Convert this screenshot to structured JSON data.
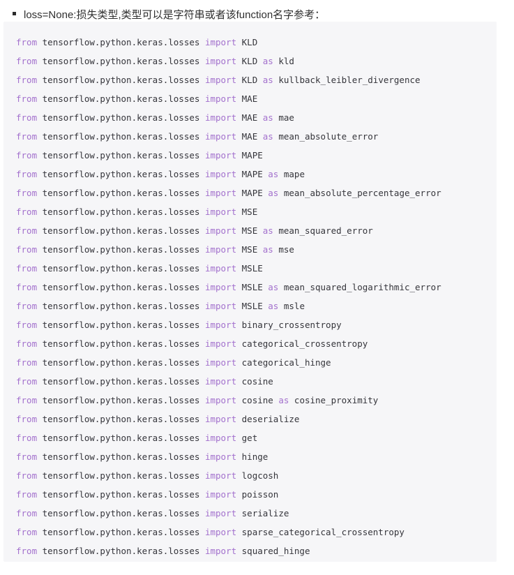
{
  "heading": {
    "bullet_icon": "square-bullet-icon",
    "text": "loss=None:损失类型,类型可以是字符串或者该function名字参考："
  },
  "code_block": {
    "language": "python",
    "background_color": "#f6f6f8",
    "keyword_color": "#a371cd",
    "text_color": "#35353b",
    "module": "tensorflow.python.keras.losses",
    "lines": [
      {
        "from_kw": "from",
        "module": "tensorflow.python.keras.losses",
        "import_kw": "import",
        "name": "KLD",
        "as_kw": "",
        "alias": ""
      },
      {
        "from_kw": "from",
        "module": "tensorflow.python.keras.losses",
        "import_kw": "import",
        "name": "KLD",
        "as_kw": "as",
        "alias": "kld"
      },
      {
        "from_kw": "from",
        "module": "tensorflow.python.keras.losses",
        "import_kw": "import",
        "name": "KLD",
        "as_kw": "as",
        "alias": "kullback_leibler_divergence"
      },
      {
        "from_kw": "from",
        "module": "tensorflow.python.keras.losses",
        "import_kw": "import",
        "name": "MAE",
        "as_kw": "",
        "alias": ""
      },
      {
        "from_kw": "from",
        "module": "tensorflow.python.keras.losses",
        "import_kw": "import",
        "name": "MAE",
        "as_kw": "as",
        "alias": "mae"
      },
      {
        "from_kw": "from",
        "module": "tensorflow.python.keras.losses",
        "import_kw": "import",
        "name": "MAE",
        "as_kw": "as",
        "alias": "mean_absolute_error"
      },
      {
        "from_kw": "from",
        "module": "tensorflow.python.keras.losses",
        "import_kw": "import",
        "name": "MAPE",
        "as_kw": "",
        "alias": ""
      },
      {
        "from_kw": "from",
        "module": "tensorflow.python.keras.losses",
        "import_kw": "import",
        "name": "MAPE",
        "as_kw": "as",
        "alias": "mape"
      },
      {
        "from_kw": "from",
        "module": "tensorflow.python.keras.losses",
        "import_kw": "import",
        "name": "MAPE",
        "as_kw": "as",
        "alias": "mean_absolute_percentage_error"
      },
      {
        "from_kw": "from",
        "module": "tensorflow.python.keras.losses",
        "import_kw": "import",
        "name": "MSE",
        "as_kw": "",
        "alias": ""
      },
      {
        "from_kw": "from",
        "module": "tensorflow.python.keras.losses",
        "import_kw": "import",
        "name": "MSE",
        "as_kw": "as",
        "alias": "mean_squared_error"
      },
      {
        "from_kw": "from",
        "module": "tensorflow.python.keras.losses",
        "import_kw": "import",
        "name": "MSE",
        "as_kw": "as",
        "alias": "mse"
      },
      {
        "from_kw": "from",
        "module": "tensorflow.python.keras.losses",
        "import_kw": "import",
        "name": "MSLE",
        "as_kw": "",
        "alias": ""
      },
      {
        "from_kw": "from",
        "module": "tensorflow.python.keras.losses",
        "import_kw": "import",
        "name": "MSLE",
        "as_kw": "as",
        "alias": "mean_squared_logarithmic_error"
      },
      {
        "from_kw": "from",
        "module": "tensorflow.python.keras.losses",
        "import_kw": "import",
        "name": "MSLE",
        "as_kw": "as",
        "alias": "msle"
      },
      {
        "from_kw": "from",
        "module": "tensorflow.python.keras.losses",
        "import_kw": "import",
        "name": "binary_crossentropy",
        "as_kw": "",
        "alias": ""
      },
      {
        "from_kw": "from",
        "module": "tensorflow.python.keras.losses",
        "import_kw": "import",
        "name": "categorical_crossentropy",
        "as_kw": "",
        "alias": ""
      },
      {
        "from_kw": "from",
        "module": "tensorflow.python.keras.losses",
        "import_kw": "import",
        "name": "categorical_hinge",
        "as_kw": "",
        "alias": ""
      },
      {
        "from_kw": "from",
        "module": "tensorflow.python.keras.losses",
        "import_kw": "import",
        "name": "cosine",
        "as_kw": "",
        "alias": ""
      },
      {
        "from_kw": "from",
        "module": "tensorflow.python.keras.losses",
        "import_kw": "import",
        "name": "cosine",
        "as_kw": "as",
        "alias": "cosine_proximity"
      },
      {
        "from_kw": "from",
        "module": "tensorflow.python.keras.losses",
        "import_kw": "import",
        "name": "deserialize",
        "as_kw": "",
        "alias": ""
      },
      {
        "from_kw": "from",
        "module": "tensorflow.python.keras.losses",
        "import_kw": "import",
        "name": "get",
        "as_kw": "",
        "alias": ""
      },
      {
        "from_kw": "from",
        "module": "tensorflow.python.keras.losses",
        "import_kw": "import",
        "name": "hinge",
        "as_kw": "",
        "alias": ""
      },
      {
        "from_kw": "from",
        "module": "tensorflow.python.keras.losses",
        "import_kw": "import",
        "name": "logcosh",
        "as_kw": "",
        "alias": ""
      },
      {
        "from_kw": "from",
        "module": "tensorflow.python.keras.losses",
        "import_kw": "import",
        "name": "poisson",
        "as_kw": "",
        "alias": ""
      },
      {
        "from_kw": "from",
        "module": "tensorflow.python.keras.losses",
        "import_kw": "import",
        "name": "serialize",
        "as_kw": "",
        "alias": ""
      },
      {
        "from_kw": "from",
        "module": "tensorflow.python.keras.losses",
        "import_kw": "import",
        "name": "sparse_categorical_crossentropy",
        "as_kw": "",
        "alias": ""
      },
      {
        "from_kw": "from",
        "module": "tensorflow.python.keras.losses",
        "import_kw": "import",
        "name": "squared_hinge",
        "as_kw": "",
        "alias": ""
      }
    ]
  }
}
